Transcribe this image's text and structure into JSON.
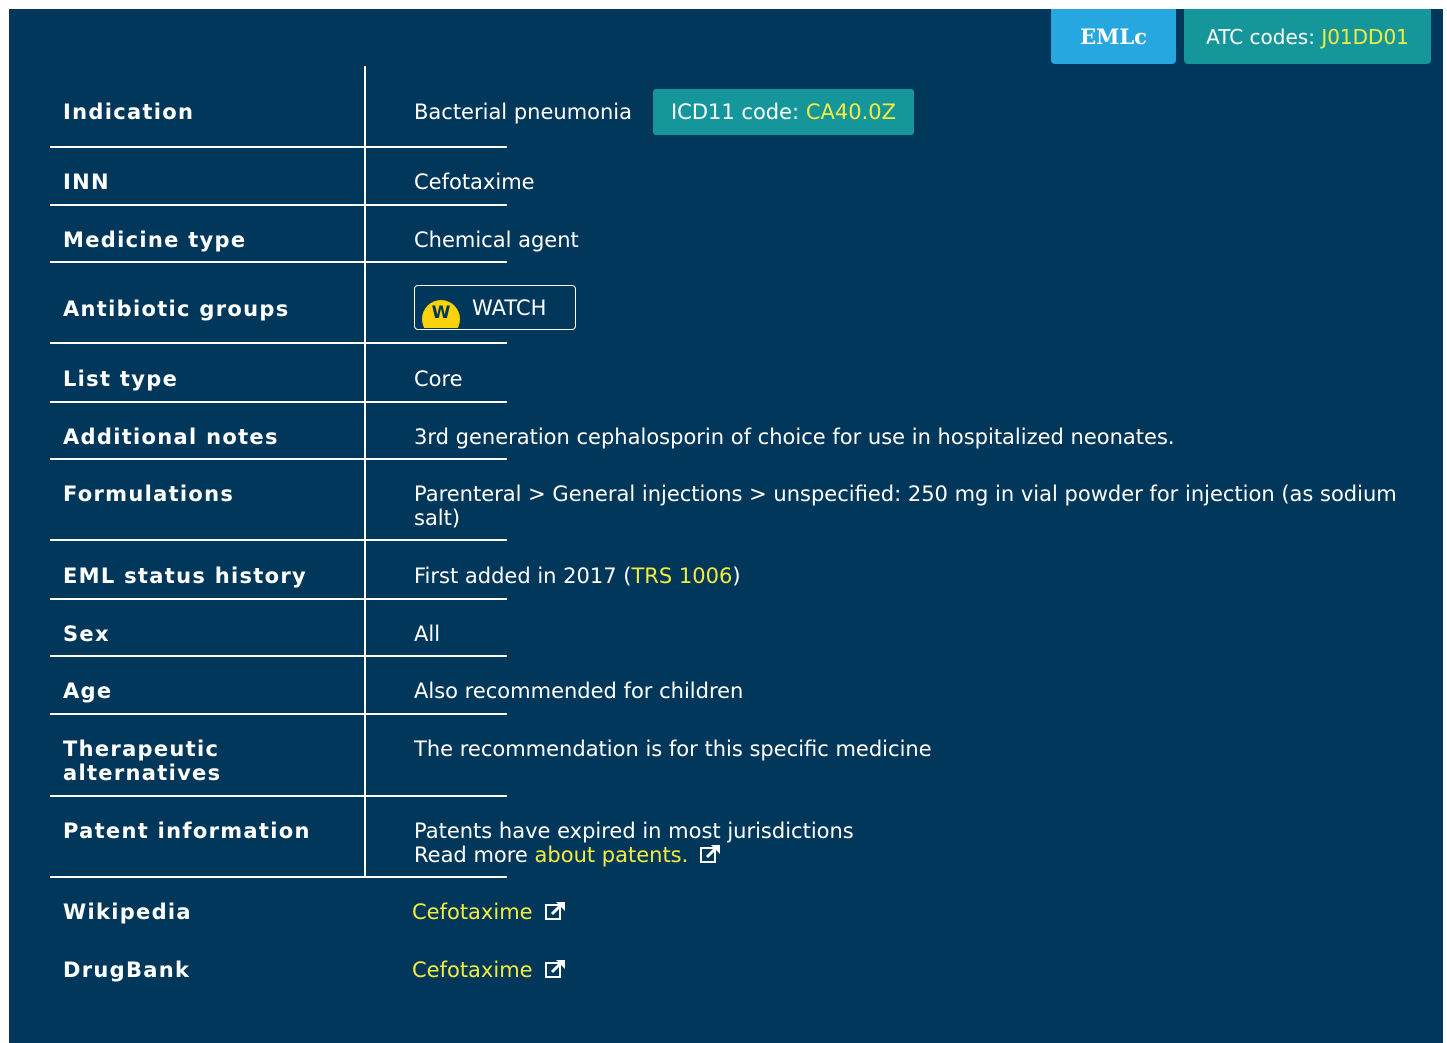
{
  "tags": {
    "emlc": "EMLc",
    "atc_label": "ATC codes: ",
    "atc_code": "J01DD01"
  },
  "rows": {
    "indication": {
      "label": "Indication",
      "value": "Bacterial pneumonia",
      "icd_label": "ICD11 code: ",
      "icd_code": "CA40.0Z"
    },
    "inn": {
      "label": "INN",
      "value": "Cefotaxime"
    },
    "medicine_type": {
      "label": "Medicine type",
      "value": "Chemical agent"
    },
    "antibiotic_groups": {
      "label": "Antibiotic groups",
      "badge_letter": "W",
      "badge_text": "WATCH"
    },
    "list_type": {
      "label": "List type",
      "value": "Core"
    },
    "additional_notes": {
      "label": "Additional notes",
      "value": "3rd generation cephalosporin of choice for use in hospitalized neonates."
    },
    "formulations": {
      "label": "Formulations",
      "value": "Parenteral > General injections > unspecified: 250 mg in vial powder for injection (as sodium salt)"
    },
    "eml_status_history": {
      "label": "EML status history",
      "prefix": "First added in 2017 (",
      "link": "TRS 1006",
      "suffix": ")"
    },
    "sex": {
      "label": "Sex",
      "value": "All"
    },
    "age": {
      "label": "Age",
      "value": "Also recommended for children"
    },
    "therapeutic_alternatives": {
      "label": "Therapeutic alternatives",
      "value": "The recommendation is for this specific medicine"
    },
    "patent_information": {
      "label": "Patent information",
      "line1": "Patents have expired in most jurisdictions",
      "line2_prefix": "Read more ",
      "link": "about patents."
    },
    "wikipedia": {
      "label": "Wikipedia",
      "link": "Cefotaxime"
    },
    "drugbank": {
      "label": "DrugBank",
      "link": "Cefotaxime"
    }
  },
  "colors": {
    "panel_bg": "#01375a",
    "emlc_tag": "#27a7e0",
    "teal_badge": "#14969b",
    "link_yellow": "#f2ec3f",
    "watch_yellow": "#f9d20a"
  }
}
